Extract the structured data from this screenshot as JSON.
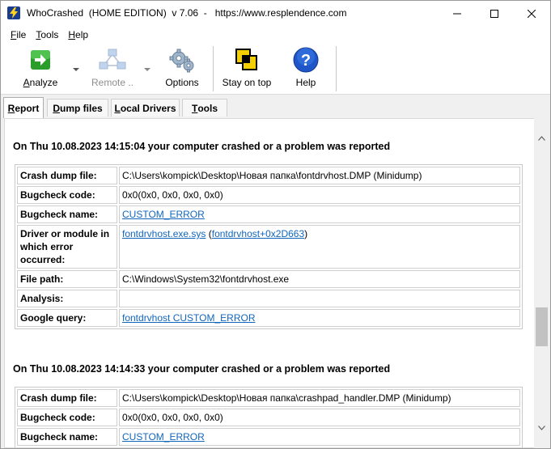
{
  "window": {
    "title": "WhoCrashed  (HOME EDITION)  v 7.06  -   https://www.resplendence.com"
  },
  "menu": [
    {
      "label": "File",
      "mnemonic": "F",
      "rest": "ile"
    },
    {
      "label": "Tools",
      "mnemonic": "T",
      "rest": "ools"
    },
    {
      "label": "Help",
      "mnemonic": "H",
      "rest": "elp"
    }
  ],
  "toolbar": {
    "analyze": {
      "mnemonic": "A",
      "rest": "nalyze",
      "icon": "green-arrow-icon"
    },
    "remote": {
      "label": "Remote ..",
      "icon": "network-icon",
      "disabled": true
    },
    "options": {
      "label": "Options",
      "icon": "gears-icon"
    },
    "stay_on_top": {
      "label": "Stay on top",
      "icon": "stacked-windows-icon"
    },
    "help": {
      "label": "Help",
      "icon": "question-icon"
    }
  },
  "tabs": [
    {
      "label": "Report",
      "mnemonic": "R",
      "rest": "eport",
      "active": true
    },
    {
      "label": "Dump files",
      "mnemonic": "D",
      "rest": "ump files",
      "active": false
    },
    {
      "label": "Local Drivers",
      "mnemonic": "L",
      "rest": "ocal Drivers",
      "active": false
    },
    {
      "label": "Tools",
      "mnemonic": "T",
      "rest": "ools",
      "active": false
    }
  ],
  "crashes": [
    {
      "heading": "On Thu 10.08.2023 14:15:04 your computer crashed or a problem was reported",
      "crash_dump_file": "C:\\Users\\kompick\\Desktop\\Новая папка\\fontdrvhost.DMP (Minidump)",
      "bugcheck_code": "0x0(0x0, 0x0, 0x0, 0x0)",
      "bugcheck_name": "CUSTOM_ERROR",
      "driver_link": "fontdrvhost.exe.sys",
      "driver_paren_open": " (",
      "driver_offset_link": "fontdrvhost+0x2D663",
      "driver_paren_close": ")",
      "file_path": "C:\\Windows\\System32\\fontdrvhost.exe",
      "analysis": "",
      "google_query": "fontdrvhost CUSTOM_ERROR"
    },
    {
      "heading": "On Thu 10.08.2023 14:14:33 your computer crashed or a problem was reported",
      "crash_dump_file": "C:\\Users\\kompick\\Desktop\\Новая папка\\crashpad_handler.DMP (Minidump)",
      "bugcheck_code": "0x0(0x0, 0x0, 0x0, 0x0)",
      "bugcheck_name": "CUSTOM_ERROR"
    }
  ],
  "labels": {
    "crash_dump_file": "Crash dump file:",
    "bugcheck_code": "Bugcheck code:",
    "bugcheck_name": "Bugcheck name:",
    "driver_or_module": "Driver or module in which error occurred:",
    "file_path": "File path:",
    "analysis": "Analysis:",
    "google_query": "Google query:"
  },
  "colors": {
    "link": "#1166bb",
    "analyze_icon": "#2a9d2a",
    "help_icon": "#1e55c8"
  }
}
